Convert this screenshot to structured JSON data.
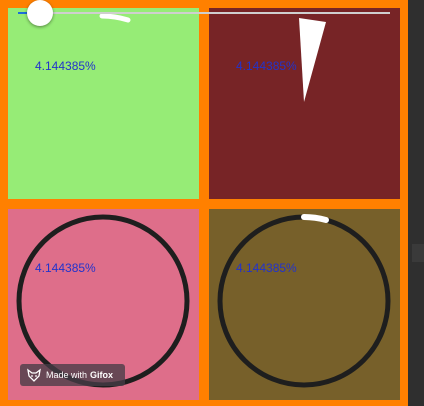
{
  "progress": {
    "percent_text": "4.144385%",
    "value_percent": 4.144385
  },
  "slider": {
    "value_fraction": 0.06
  },
  "cells": [
    {
      "name": "green",
      "color": "#96ec76"
    },
    {
      "name": "red",
      "color": "#772426"
    },
    {
      "name": "pink",
      "color": "#de6e8a"
    },
    {
      "name": "olive",
      "color": "#77602a"
    }
  ],
  "colors": {
    "frame": "#ff8000",
    "text": "#2233cc",
    "ring": "#1e1e1e",
    "indicator": "#ffffff"
  },
  "badge": {
    "made_with": "Made with",
    "brand": "Gifox"
  }
}
